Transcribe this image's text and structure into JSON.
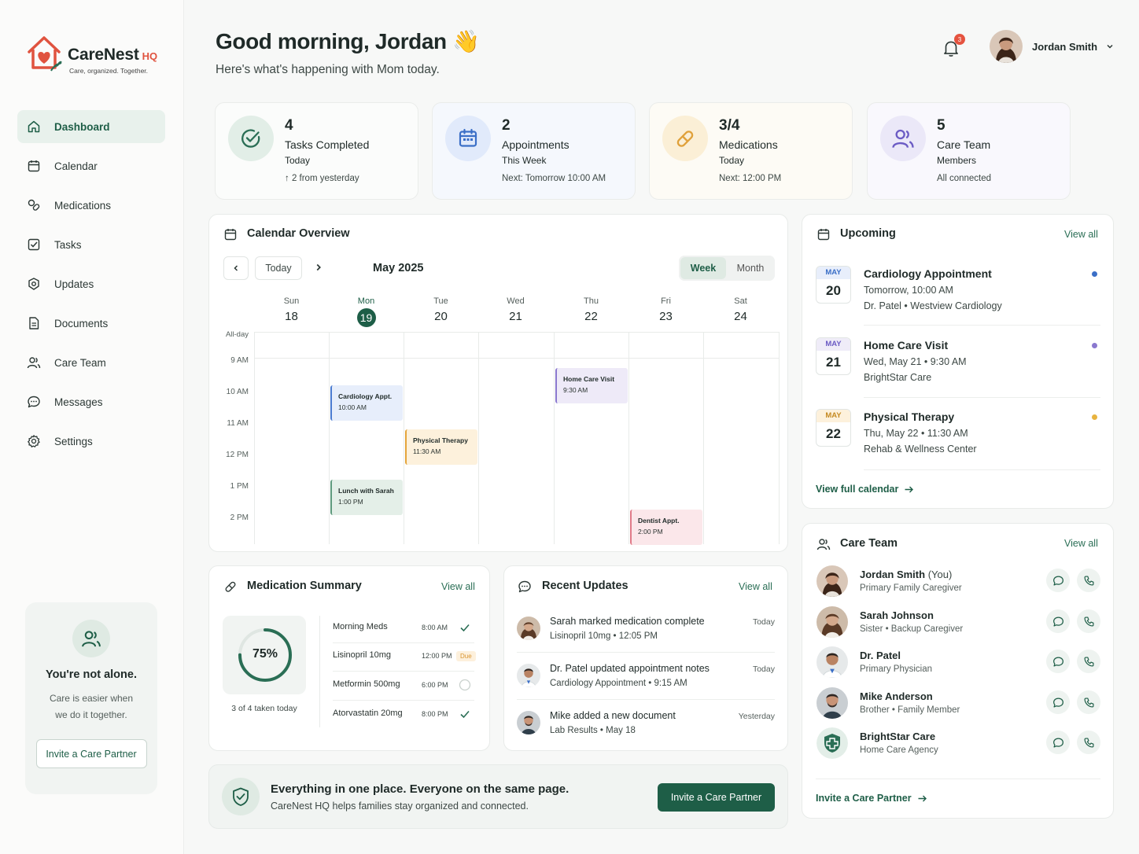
{
  "brand": {
    "name": "CareNest",
    "suffix": "HQ",
    "tagline": "Care, organized. Together."
  },
  "nav": [
    {
      "label": "Dashboard",
      "icon": "home-icon",
      "active": true
    },
    {
      "label": "Calendar",
      "icon": "calendar-icon"
    },
    {
      "label": "Medications",
      "icon": "pill-icon"
    },
    {
      "label": "Tasks",
      "icon": "checkbox-icon"
    },
    {
      "label": "Updates",
      "icon": "updates-icon"
    },
    {
      "label": "Documents",
      "icon": "document-icon"
    },
    {
      "label": "Care Team",
      "icon": "users-icon"
    },
    {
      "label": "Messages",
      "icon": "message-icon"
    },
    {
      "label": "Settings",
      "icon": "gear-icon"
    }
  ],
  "sidebar_card": {
    "title": "You're not alone.",
    "line1": "Care is easier when",
    "line2": "we do it together.",
    "button": "Invite a Care Partner"
  },
  "header": {
    "greeting": "Good morning, Jordan 👋",
    "subtitle": "Here's what's happening with Mom today.",
    "notifications": "3",
    "user_name": "Jordan Smith"
  },
  "stats": [
    {
      "value": "4",
      "label": "Tasks Completed",
      "sub": "Today",
      "meta": "↑ 2 from yesterday",
      "icon": "check-circle-icon",
      "color": "#2a6e55"
    },
    {
      "value": "2",
      "label": "Appointments",
      "sub": "This Week",
      "meta": "Next: Tomorrow 10:00 AM",
      "icon": "calendar-icon",
      "color": "#3b6fc7"
    },
    {
      "value": "3/4",
      "label": "Medications",
      "sub": "Today",
      "meta": "Next: 12:00 PM",
      "icon": "pill-icon",
      "color": "#e0a13a"
    },
    {
      "value": "5",
      "label": "Care Team",
      "sub": "Members",
      "meta": "All connected",
      "icon": "users-icon",
      "color": "#6b5bc4"
    }
  ],
  "calendar": {
    "title": "Calendar Overview",
    "today_button": "Today",
    "month": "May 2025",
    "view_week": "Week",
    "view_month": "Month",
    "all_day_label": "All-day",
    "days": [
      {
        "name": "Sun",
        "date": "18"
      },
      {
        "name": "Mon",
        "date": "19",
        "today": true
      },
      {
        "name": "Tue",
        "date": "20"
      },
      {
        "name": "Wed",
        "date": "21"
      },
      {
        "name": "Thu",
        "date": "22"
      },
      {
        "name": "Fri",
        "date": "23"
      },
      {
        "name": "Sat",
        "date": "24"
      }
    ],
    "times": [
      "9 AM",
      "10 AM",
      "11 AM",
      "12 PM",
      "1 PM",
      "2 PM"
    ],
    "events": [
      {
        "title": "Cardiology Appt.",
        "time": "10:00 AM",
        "day": 1,
        "bg": "#e7eefb",
        "border": "#4a7bd0"
      },
      {
        "title": "Physical Therapy",
        "time": "11:30 AM",
        "day": 2,
        "bg": "#fdf1dc",
        "border": "#e4a53b"
      },
      {
        "title": "Home Care Visit",
        "time": "9:30 AM",
        "day": 4,
        "bg": "#eeeaf8",
        "border": "#8a78cf"
      },
      {
        "title": "Lunch with Sarah",
        "time": "1:00 PM",
        "day": 1,
        "bg": "#e4efe8",
        "border": "#5e9a7d"
      },
      {
        "title": "Dentist Appt.",
        "time": "2:00 PM",
        "day": 5,
        "bg": "#fbe7ea",
        "border": "#e07a88"
      }
    ]
  },
  "upcoming": {
    "title": "Upcoming",
    "view_all": "View all",
    "items": [
      {
        "month": "MAY",
        "day": "20",
        "title": "Cardiology Appointment",
        "line1": "Tomorrow, 10:00 AM",
        "line2": "Dr. Patel • Westview Cardiology",
        "dot": "#3b6fc7",
        "mbg": "#e8eefb",
        "mcolor": "#3b6fc7"
      },
      {
        "month": "MAY",
        "day": "21",
        "title": "Home Care Visit",
        "line1": "Wed, May 21 • 9:30 AM",
        "line2": "BrightStar Care",
        "dot": "#8a78cf",
        "mbg": "#efecf8",
        "mcolor": "#6b5bc4"
      },
      {
        "month": "MAY",
        "day": "22",
        "title": "Physical Therapy",
        "line1": "Thu, May 22 • 11:30 AM",
        "line2": "Rehab & Wellness Center",
        "dot": "#e8b33f",
        "mbg": "#fdf1dc",
        "mcolor": "#c58a22"
      }
    ],
    "footer_link": "View full calendar"
  },
  "care_team": {
    "title": "Care Team",
    "view_all": "View all",
    "members": [
      {
        "name": "Jordan Smith",
        "you": "(You)",
        "role": "Primary Family Caregiver"
      },
      {
        "name": "Sarah Johnson",
        "you": "",
        "role": "Sister • Backup Caregiver"
      },
      {
        "name": "Dr. Patel",
        "you": "",
        "role": "Primary Physician"
      },
      {
        "name": "Mike Anderson",
        "you": "",
        "role": "Brother • Family Member"
      },
      {
        "name": "BrightStar Care",
        "you": "",
        "role": "Home Care Agency"
      }
    ],
    "footer_link": "Invite a Care Partner"
  },
  "medication_summary": {
    "title": "Medication Summary",
    "view_all": "View all",
    "percent": 75,
    "percent_label": "75%",
    "caption": "3 of 4 taken today",
    "meds": [
      {
        "name": "Morning Meds",
        "time": "8:00 AM",
        "status": "taken"
      },
      {
        "name": "Lisinopril 10mg",
        "time": "12:00 PM",
        "status": "due",
        "status_label": "Due"
      },
      {
        "name": "Metformin 500mg",
        "time": "6:00 PM",
        "status": "pending"
      },
      {
        "name": "Atorvastatin 20mg",
        "time": "8:00 PM",
        "status": "taken"
      }
    ]
  },
  "recent_updates": {
    "title": "Recent Updates",
    "view_all": "View all",
    "items": [
      {
        "text": "Sarah marked medication complete",
        "sub": "Lisinopril 10mg • 12:05 PM",
        "when": "Today"
      },
      {
        "text": "Dr. Patel updated appointment notes",
        "sub": "Cardiology Appointment • 9:15 AM",
        "when": "Today"
      },
      {
        "text": "Mike added a new document",
        "sub": "Lab Results • May 18",
        "when": "Yesterday"
      }
    ]
  },
  "banner": {
    "title": "Everything in one place. Everyone on the same page.",
    "subtitle": "CareNest HQ helps families stay organized and connected.",
    "button": "Invite a Care Partner"
  }
}
